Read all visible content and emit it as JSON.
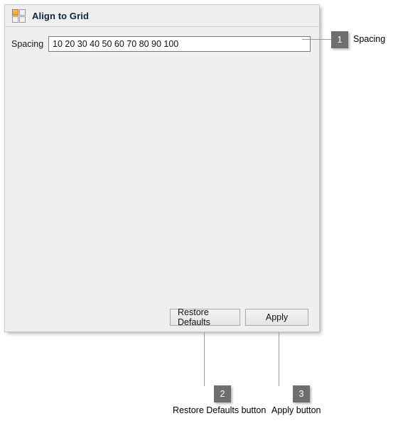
{
  "dialog": {
    "title": "Align to Grid",
    "icon": "grid-2x2-icon",
    "field": {
      "label": "Spacing",
      "value": "10 20 30 40 50 60 70 80 90 100",
      "placeholder": "10 20 30 40 50 60 70 80 90 100"
    },
    "buttons": {
      "restore_defaults": "Restore Defaults",
      "apply": "Apply"
    }
  },
  "callouts": [
    {
      "number": "1",
      "label": "Spacing"
    },
    {
      "number": "2",
      "label": "Restore Defaults button"
    },
    {
      "number": "3",
      "label": "Apply button"
    }
  ],
  "colors": {
    "panel_background": "#efefef",
    "panel_border": "#c8c8c8",
    "title_text": "#11223d",
    "input_background": "#ffffff",
    "input_border": "#7a7a7a",
    "button_border": "#a9a9a9",
    "marker_background": "#6e6e6e",
    "marker_text": "#ffffff",
    "callout_line": "#9a9a9a",
    "icon_highlight": "#f39c21"
  }
}
